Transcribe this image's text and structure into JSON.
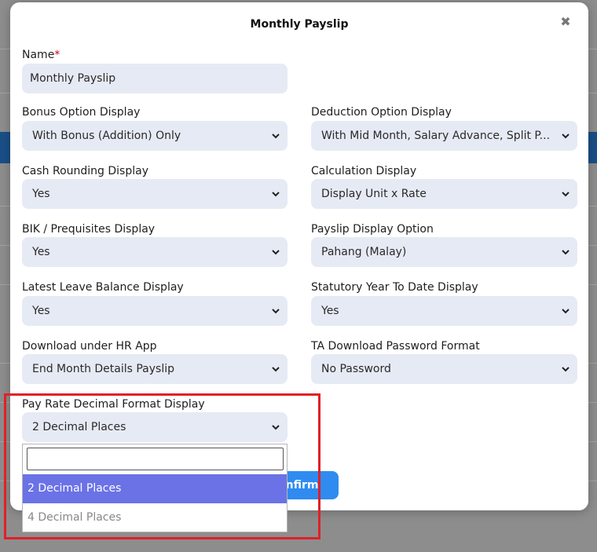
{
  "modal": {
    "title": "Monthly Payslip",
    "close_glyph": "✖"
  },
  "name_field": {
    "label": "Name",
    "required_mark": "*",
    "value": "Monthly Payslip"
  },
  "fields": {
    "bonus_option": {
      "label": "Bonus Option Display",
      "value": "With Bonus (Addition) Only"
    },
    "deduction_option": {
      "label": "Deduction Option Display",
      "value": "With Mid Month, Salary Advance, Split P..."
    },
    "cash_rounding": {
      "label": "Cash Rounding Display",
      "value": "Yes"
    },
    "calculation": {
      "label": "Calculation Display",
      "value": "Display Unit x Rate"
    },
    "bik": {
      "label": "BIK / Prequisites Display",
      "value": "Yes"
    },
    "payslip_option": {
      "label": "Payslip Display Option",
      "value": "Pahang (Malay)"
    },
    "leave_balance": {
      "label": "Latest Leave Balance Display",
      "value": "Yes"
    },
    "statutory_ytd": {
      "label": "Statutory Year To Date Display",
      "value": "Yes"
    },
    "download_hr": {
      "label": "Download under HR App",
      "value": "End Month Details Payslip"
    },
    "ta_password": {
      "label": "TA Download Password Format",
      "value": "No Password"
    },
    "pay_rate_decimal": {
      "label": "Pay Rate Decimal Format Display",
      "value": "2 Decimal Places"
    }
  },
  "dropdown": {
    "search_value": "",
    "options": [
      "2 Decimal Places",
      "4 Decimal Places"
    ]
  },
  "confirm_label": "onfirm",
  "icons": {
    "chevron": "chevron-down-icon"
  },
  "colors": {
    "accent": "#2f8bf0",
    "selected_option": "#6a72e6",
    "highlight": "#e02028",
    "input_bg": "#e6eaf4"
  }
}
